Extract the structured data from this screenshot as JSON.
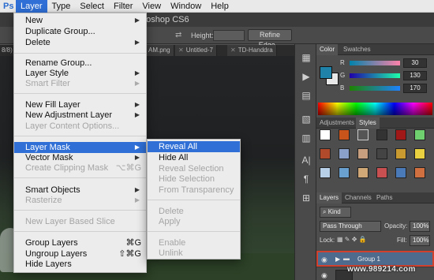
{
  "menubar": {
    "items": [
      "Ps",
      "Layer",
      "Type",
      "Select",
      "Filter",
      "View",
      "Window",
      "Help"
    ]
  },
  "window": {
    "title": "otoshop CS6"
  },
  "options_bar": {
    "height_label": "Height:",
    "refine_edge": "Refine Edge..."
  },
  "document_tabs": {
    "size_text": "8/8)",
    "tabs": [
      "AM.png",
      "Untitled-7",
      "TD-Handdra"
    ]
  },
  "layer_menu": {
    "items": [
      {
        "label": "New",
        "arrow": true,
        "disabled": false
      },
      {
        "label": "Duplicate Group...",
        "disabled": false
      },
      {
        "label": "Delete",
        "arrow": true,
        "disabled": false
      },
      {
        "label": "Rename Group...",
        "disabled": false
      },
      {
        "label": "Layer Style",
        "arrow": true,
        "disabled": false
      },
      {
        "label": "Smart Filter",
        "arrow": true,
        "disabled": true
      },
      {
        "label": "New Fill Layer",
        "arrow": true,
        "disabled": false
      },
      {
        "label": "New Adjustment Layer",
        "arrow": true,
        "disabled": false
      },
      {
        "label": "Layer Content Options...",
        "disabled": true
      },
      {
        "label": "Layer Mask",
        "arrow": true,
        "disabled": false,
        "highlighted": true
      },
      {
        "label": "Vector Mask",
        "arrow": true,
        "disabled": false
      },
      {
        "label": "Create Clipping Mask",
        "shortcut": "⌥⌘G",
        "disabled": true
      },
      {
        "label": "Smart Objects",
        "arrow": true,
        "disabled": false
      },
      {
        "label": "Rasterize",
        "arrow": true,
        "disabled": true
      },
      {
        "label": "New Layer Based Slice",
        "disabled": true
      },
      {
        "label": "Group Layers",
        "shortcut": "⌘G",
        "disabled": false
      },
      {
        "label": "Ungroup Layers",
        "shortcut": "⇧⌘G",
        "disabled": false
      },
      {
        "label": "Hide Layers",
        "disabled": false
      }
    ]
  },
  "layer_mask_submenu": {
    "items": [
      {
        "label": "Reveal All",
        "disabled": false,
        "highlighted": true
      },
      {
        "label": "Hide All",
        "disabled": false
      },
      {
        "label": "Reveal Selection",
        "disabled": true
      },
      {
        "label": "Hide Selection",
        "disabled": true
      },
      {
        "label": "From Transparency",
        "disabled": true
      },
      {
        "label": "Delete",
        "disabled": true
      },
      {
        "label": "Apply",
        "disabled": true
      },
      {
        "label": "Enable",
        "disabled": true
      },
      {
        "label": "Unlink",
        "disabled": true
      }
    ]
  },
  "color_panel": {
    "tabs": [
      "Color",
      "Swatches"
    ],
    "r_label": "R",
    "g_label": "G",
    "b_label": "B",
    "r": "30",
    "g": "130",
    "b": "170",
    "foreground": "#1e82aa"
  },
  "styles_panel": {
    "tabs": [
      "Adjustments",
      "Styles"
    ]
  },
  "layers_panel": {
    "tabs": [
      "Layers",
      "Channels",
      "Paths"
    ],
    "kind": "Kind",
    "blend_mode": "Pass Through",
    "opacity_label": "Opacity:",
    "opacity": "100%",
    "lock_label": "Lock:",
    "fill_label": "Fill:",
    "fill": "100%",
    "layer_name": "Group 1"
  },
  "watermark": "www.989214.com",
  "colors": {
    "menu_highlight": "#2f6fd6",
    "selection_outline": "#d0402c"
  }
}
